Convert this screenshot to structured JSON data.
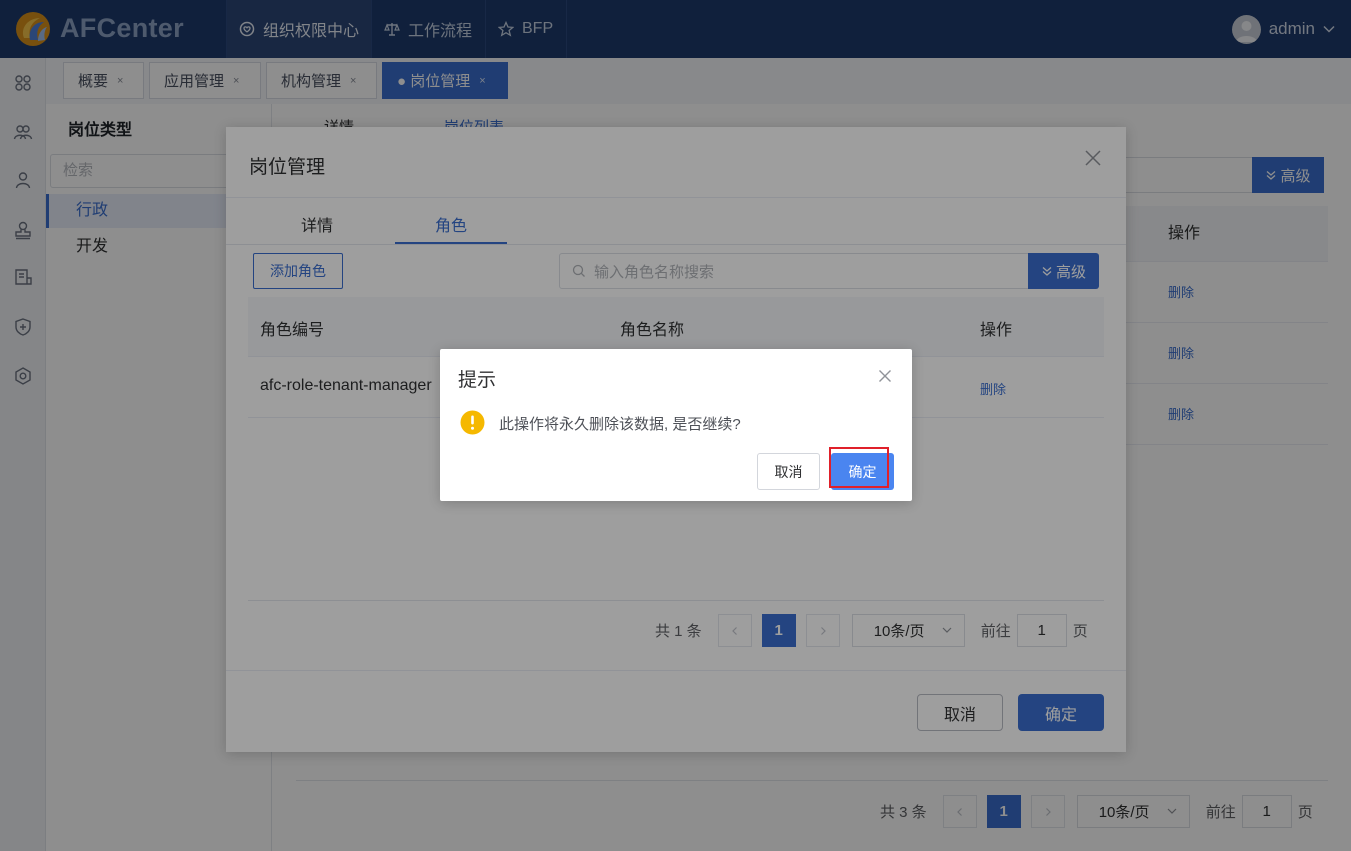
{
  "app": {
    "brand": "AFCenter",
    "user": "admin"
  },
  "nav": [
    {
      "label": "组织权限中心",
      "icon": "heart-shield-icon"
    },
    {
      "label": "工作流程",
      "icon": "scale-icon"
    },
    {
      "label": "BFP",
      "icon": "star-icon"
    }
  ],
  "rail_icons": [
    "grid-icon",
    "team-icon",
    "user-icon",
    "stamp-icon",
    "form-icon",
    "shield-plus-icon",
    "settings-hex-icon"
  ],
  "tabs": [
    {
      "label": "概要",
      "close": "×"
    },
    {
      "label": "应用管理",
      "close": "×"
    },
    {
      "label": "机构管理",
      "close": "×"
    },
    {
      "label": "● 岗位管理",
      "close": "×"
    }
  ],
  "side": {
    "title": "岗位类型",
    "search_placeholder": "检索",
    "items": [
      "行政",
      "开发"
    ]
  },
  "background": {
    "tabs": [
      "详情",
      "岗位列表"
    ],
    "advanced": "高级",
    "col_op": "操作",
    "row_actions": [
      "删除",
      "删除",
      "删除"
    ],
    "pager": {
      "total": "共 3 条",
      "page": "1",
      "size": "10条/页",
      "goto": "前往",
      "goto_value": "1",
      "page_unit": "页"
    }
  },
  "dialog": {
    "title": "岗位管理",
    "tabs": [
      "详情",
      "角色"
    ],
    "add_role": "添加角色",
    "search_placeholder": "输入角色名称搜索",
    "advanced": "高级",
    "columns": [
      "角色编号",
      "角色名称",
      "操作"
    ],
    "rows": [
      {
        "code": "afc-role-tenant-manager",
        "name": "",
        "action": "删除"
      }
    ],
    "pager": {
      "total": "共 1 条",
      "page": "1",
      "size": "10条/页",
      "goto": "前往",
      "goto_value": "1",
      "page_unit": "页"
    },
    "cancel": "取消",
    "ok": "确定"
  },
  "message_box": {
    "title": "提示",
    "text": "此操作将永久删除该数据, 是否继续?",
    "cancel": "取消",
    "ok": "确定"
  },
  "colors": {
    "topbar": "#1f3b6c",
    "primary": "#3a6fd0",
    "confirm": "#4a85f0",
    "warning": "#f5b800",
    "highlight": "#e0202a"
  }
}
